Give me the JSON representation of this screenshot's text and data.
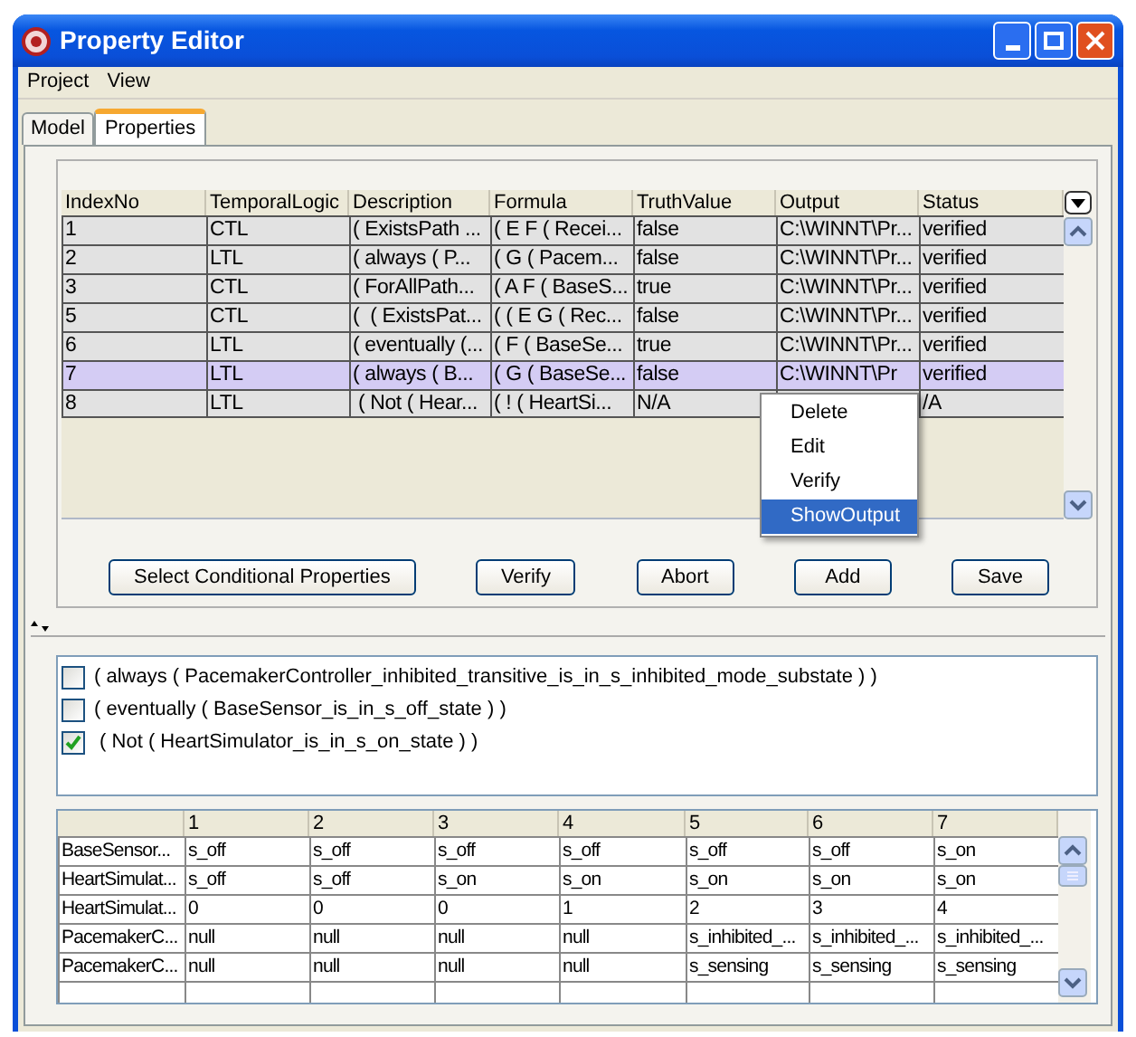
{
  "window": {
    "title": "Property Editor"
  },
  "menu": [
    "Project",
    "View"
  ],
  "tabs": [
    {
      "label": "Model",
      "selected": false
    },
    {
      "label": "Properties",
      "selected": true
    }
  ],
  "properties_table": {
    "columns": [
      "IndexNo",
      "TemporalLogic",
      "Description",
      "Formula",
      "TruthValue",
      "Output",
      "Status"
    ],
    "rows": [
      {
        "cells": [
          "1",
          "CTL",
          "( ExistsPath ...",
          "( E F ( Recei...",
          "false",
          "C:\\WINNT\\Pr...",
          "verified"
        ],
        "selected": false
      },
      {
        "cells": [
          "2",
          "LTL",
          "( always ( P...",
          "( G ( Pacem...",
          "false",
          "C:\\WINNT\\Pr...",
          "verified"
        ],
        "selected": false
      },
      {
        "cells": [
          "3",
          "CTL",
          "( ForAllPath...",
          "( A F ( BaseS...",
          "true",
          "C:\\WINNT\\Pr...",
          "verified"
        ],
        "selected": false
      },
      {
        "cells": [
          "5",
          "CTL",
          "(  ( ExistsPat...",
          "( ( E G ( Rec...",
          "false",
          "C:\\WINNT\\Pr...",
          "verified"
        ],
        "selected": false
      },
      {
        "cells": [
          "6",
          "LTL",
          "( eventually (...",
          "( F ( BaseSe...",
          "true",
          "C:\\WINNT\\Pr...",
          "verified"
        ],
        "selected": false
      },
      {
        "cells": [
          "7",
          "LTL",
          "( always ( B...",
          "( G ( BaseSe...",
          "false",
          "C:\\WINNT\\Pr",
          "verified"
        ],
        "selected": true
      },
      {
        "cells": [
          "8",
          "LTL",
          " ( Not ( Hear...",
          "( ! ( HeartSi...",
          "N/A",
          "",
          "/A"
        ],
        "selected": false
      }
    ]
  },
  "context_menu": [
    {
      "label": "Delete",
      "selected": false
    },
    {
      "label": "Edit",
      "selected": false
    },
    {
      "label": "Verify",
      "selected": false
    },
    {
      "label": "ShowOutput",
      "selected": true
    }
  ],
  "buttons": [
    "Select Conditional Properties",
    "Verify",
    "Abort",
    "Add",
    "Save"
  ],
  "conditions": [
    {
      "label": "( always ( PacemakerController_inhibited_transitive_is_in_s_inhibited_mode_substate ) )",
      "checked": false
    },
    {
      "label": "( eventually ( BaseSensor_is_in_s_off_state ) )",
      "checked": false
    },
    {
      "label": " ( Not ( HeartSimulator_is_in_s_on_state ) )",
      "checked": true
    }
  ],
  "trace_table": {
    "columns": [
      "",
      "1",
      "2",
      "3",
      "4",
      "5",
      "6",
      "7"
    ],
    "rows": [
      [
        "BaseSensor...",
        "s_off",
        "s_off",
        "s_off",
        "s_off",
        "s_off",
        "s_off",
        "s_on"
      ],
      [
        "HeartSimulat...",
        "s_off",
        "s_off",
        "s_on",
        "s_on",
        "s_on",
        "s_on",
        "s_on"
      ],
      [
        "HeartSimulat...",
        "0",
        "0",
        "0",
        "1",
        "2",
        "3",
        "4"
      ],
      [
        "PacemakerC...",
        "null",
        "null",
        "null",
        "null",
        "s_inhibited_...",
        "s_inhibited_...",
        "s_inhibited_..."
      ],
      [
        "PacemakerC...",
        "null",
        "null",
        "null",
        "null",
        "s_sensing",
        "s_sensing",
        "s_sensing"
      ]
    ]
  }
}
